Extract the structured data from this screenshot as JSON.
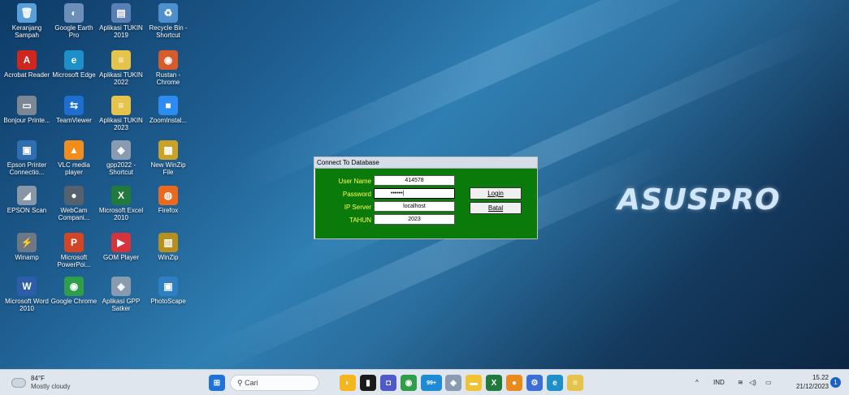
{
  "desktop_icons": [
    {
      "label": "Keranjang Sampah",
      "glyph": "🗑",
      "color": "#5aa0d8"
    },
    {
      "label": "Google Earth Pro",
      "glyph": "◐",
      "color": "#6b8fb8"
    },
    {
      "label": "Aplikasi TUKIN 2019",
      "glyph": "▤",
      "color": "#5a7fb5"
    },
    {
      "label": "Recycle Bin - Shortcut",
      "glyph": "♻",
      "color": "#4e8fce"
    },
    {
      "label": "Acrobat Reader",
      "glyph": "A",
      "color": "#d0261f"
    },
    {
      "label": "Microsoft Edge",
      "glyph": "e",
      "color": "#1d8fc9"
    },
    {
      "label": "Aplikasi TUKIN 2022",
      "glyph": "≡",
      "color": "#e6c34a"
    },
    {
      "label": "Rustan - Chrome",
      "glyph": "◉",
      "color": "#d65c2c"
    },
    {
      "label": "Bonjour Printe...",
      "glyph": "▭",
      "color": "#7b8794"
    },
    {
      "label": "TeamViewer",
      "glyph": "⇆",
      "color": "#1d6ecf"
    },
    {
      "label": "Aplikasi TUKIN 2023",
      "glyph": "≡",
      "color": "#e6c34a"
    },
    {
      "label": "ZoomInstal...",
      "glyph": "■",
      "color": "#2d8cf0"
    },
    {
      "label": "Epson Printer Connectio...",
      "glyph": "▣",
      "color": "#2f6eb1"
    },
    {
      "label": "VLC media player",
      "glyph": "▲",
      "color": "#f28c1b"
    },
    {
      "label": "gpp2022 - Shortcut",
      "glyph": "◈",
      "color": "#8a9bb0"
    },
    {
      "label": "New WinZip File",
      "glyph": "▦",
      "color": "#c9a227"
    },
    {
      "label": "EPSON Scan",
      "glyph": "◢",
      "color": "#8797a8"
    },
    {
      "label": "WebCam Compani...",
      "glyph": "●",
      "color": "#55616e"
    },
    {
      "label": "Microsoft Excel 2010",
      "glyph": "X",
      "color": "#1f7a3b"
    },
    {
      "label": "Firefox",
      "glyph": "◍",
      "color": "#e96a1f"
    },
    {
      "label": "Winamp",
      "glyph": "⚡",
      "color": "#6d7884"
    },
    {
      "label": "Microsoft PowerPoi...",
      "glyph": "P",
      "color": "#d24625"
    },
    {
      "label": "GOM Player",
      "glyph": "▶",
      "color": "#d6333a"
    },
    {
      "label": "WinZip",
      "glyph": "▥",
      "color": "#b78f1e"
    },
    {
      "label": "Microsoft Word 2010",
      "glyph": "W",
      "color": "#2b5da8"
    },
    {
      "label": "Google Chrome",
      "glyph": "◉",
      "color": "#2f9e4a"
    },
    {
      "label": "Aplikasi GPP Satker",
      "glyph": "◈",
      "color": "#8a9bb0"
    },
    {
      "label": "PhotoScape",
      "glyph": "▣",
      "color": "#2d7fc2"
    }
  ],
  "brand": "ASUSPRO",
  "dialog": {
    "title": "Connect To Database",
    "fields": [
      {
        "label": "User Name",
        "value": "414578"
      },
      {
        "label": "Password",
        "value": "••••••"
      },
      {
        "label": "IP Server",
        "value": "localhost"
      },
      {
        "label": "TAHUN",
        "value": "2023"
      }
    ],
    "login_label": "Login",
    "cancel_label": "Batal"
  },
  "taskbar": {
    "weather_temp": "84°F",
    "weather_desc": "Mostly cloudy",
    "search_placeholder": "Cari",
    "language": "IND",
    "time": "15.22",
    "date": "21/12/2023",
    "notification_count": "1",
    "edge_badge": "99+"
  }
}
